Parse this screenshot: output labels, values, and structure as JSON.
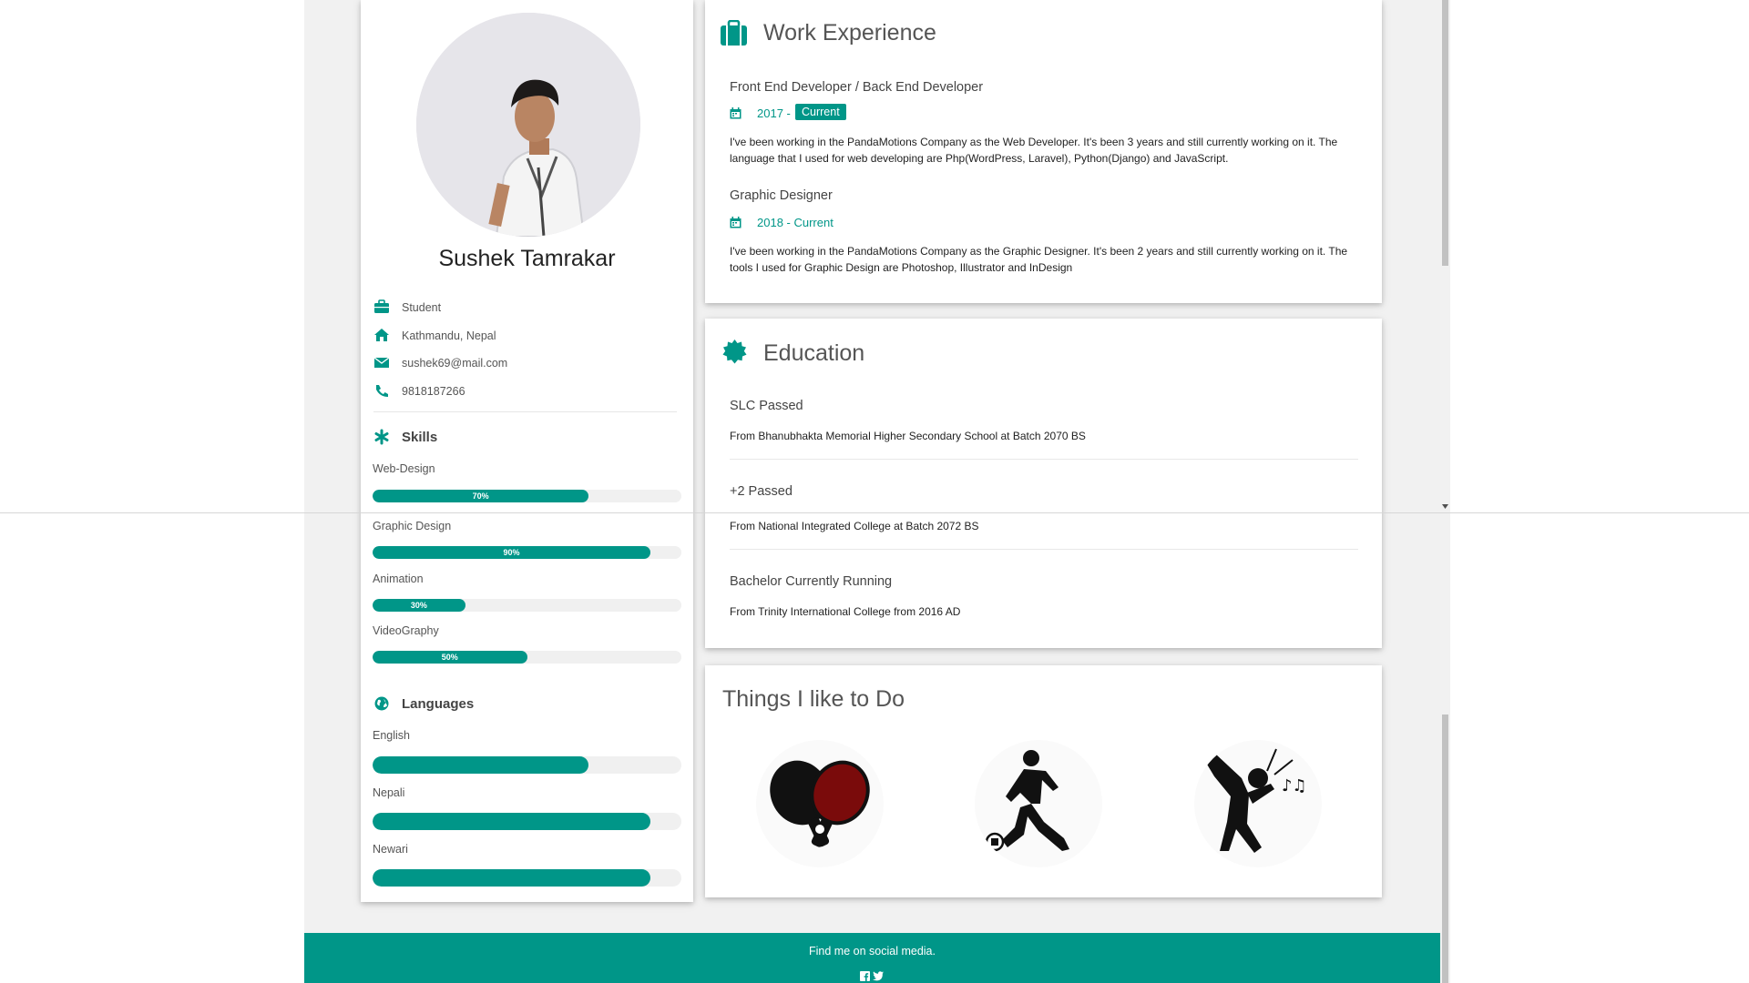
{
  "profile": {
    "name": "Sushek Tamrakar",
    "info": {
      "occupation": "Student",
      "location": "Kathmandu, Nepal",
      "email": "sushek69@mail.com",
      "phone": "9818187266"
    },
    "skills_heading": "Skills",
    "skills": [
      {
        "label": "Web-Design",
        "percent": 70,
        "percent_text": "70%"
      },
      {
        "label": "Graphic Design",
        "percent": 90,
        "percent_text": "90%"
      },
      {
        "label": "Animation",
        "percent": 30,
        "percent_text": "30%"
      },
      {
        "label": "VideoGraphy",
        "percent": 50,
        "percent_text": "50%"
      }
    ],
    "languages_heading": "Languages",
    "languages": [
      {
        "label": "English",
        "percent": 70
      },
      {
        "label": "Nepali",
        "percent": 90
      },
      {
        "label": "Newari",
        "percent": 90
      }
    ]
  },
  "work": {
    "title": "Work Experience",
    "jobs": [
      {
        "title": "Front End Developer / Back End Developer",
        "date": "2017 -",
        "tag": "Current",
        "description": "I've been working in the PandaMotions Company as the Web Developer. It's been 3 years and still currently working on it. The language that I used for web developing are Php(WordPress, Laravel), Python(Django) and JavaScript."
      },
      {
        "title": "Graphic Designer",
        "date": "2018 - Current",
        "description": "I've been working in the PandaMotions Company as the Graphic Designer. It's been 2 years and still currently working on it. The tools I used for Graphic Design are Photoshop, Illustrator and InDesign"
      }
    ]
  },
  "education": {
    "title": "Education",
    "items": [
      {
        "title": "SLC Passed",
        "description": "From Bhanubhakta Memorial Higher Secondary School at Batch 2070 BS"
      },
      {
        "title": "+2 Passed",
        "description": "From National Integrated College at Batch 2072 BS"
      },
      {
        "title": "Bachelor Currently Running",
        "description": "From Trinity International College from 2016 AD"
      }
    ]
  },
  "hobbies": {
    "title": "Things I like to Do",
    "icons": [
      "table-tennis-icon",
      "football-icon",
      "singing-icon"
    ]
  },
  "footer": {
    "text": "Find me on social media.",
    "social_icons": [
      "facebook-icon",
      "twitter-icon"
    ]
  },
  "colors": {
    "accent": "#009688",
    "background": "#f1f1f1",
    "paddle_red": "#7a0b0b"
  }
}
